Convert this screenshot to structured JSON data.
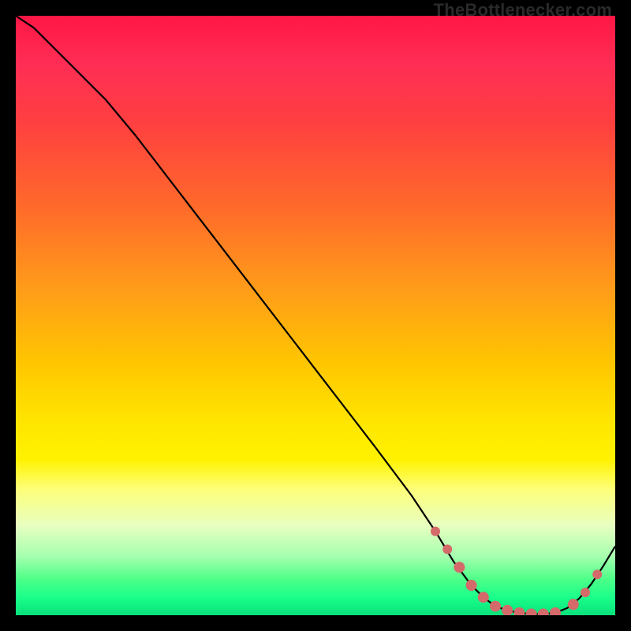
{
  "watermark": "TheBottlenecker.com",
  "colors": {
    "curve": "#000000",
    "marker": "#d46a6a",
    "markerStroke": "#b94f4f"
  },
  "chart_data": {
    "type": "line",
    "title": "",
    "xlabel": "",
    "ylabel": "",
    "xlim": [
      0,
      100
    ],
    "ylim": [
      0,
      100
    ],
    "series": [
      {
        "name": "bottleneck-curve",
        "x": [
          0,
          3,
          6,
          10,
          15,
          20,
          30,
          40,
          50,
          60,
          66,
          70,
          73,
          76,
          78,
          80,
          82,
          84,
          86,
          88,
          90,
          92,
          94,
          96,
          98,
          100
        ],
        "y": [
          100,
          98,
          95,
          91,
          86,
          80,
          67,
          54,
          41,
          28,
          20,
          14,
          9,
          5,
          3,
          1.5,
          0.8,
          0.4,
          0.2,
          0.2,
          0.4,
          1.2,
          2.8,
          5.2,
          8.2,
          11.5
        ]
      }
    ],
    "markers": {
      "name": "highlight-dots",
      "x": [
        70,
        72,
        74,
        76,
        78,
        80,
        82,
        84,
        86,
        88,
        90,
        93,
        95,
        97
      ],
      "y": [
        14,
        11,
        8,
        5,
        3,
        1.5,
        0.8,
        0.4,
        0.2,
        0.2,
        0.4,
        1.8,
        3.8,
        6.8
      ]
    }
  }
}
